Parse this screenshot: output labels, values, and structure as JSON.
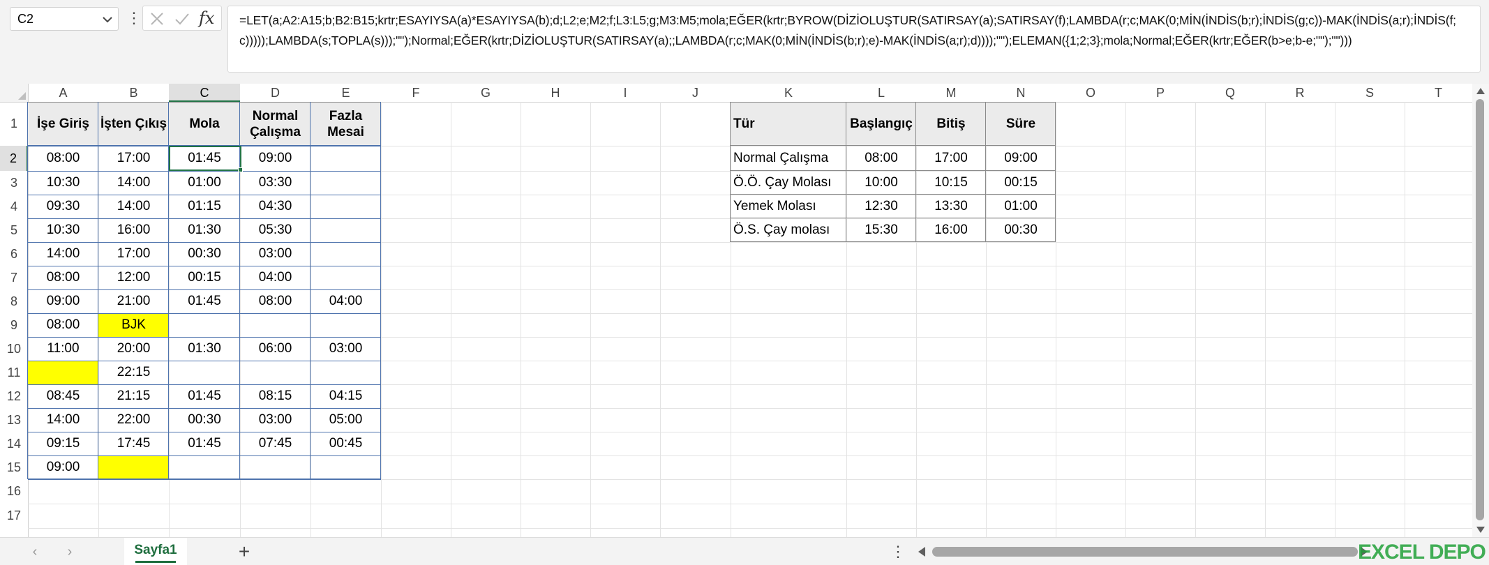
{
  "formula_bar": {
    "name_box": "C2",
    "formula": "=LET(a;A2:A15;b;B2:B15;krtr;ESAYIYSA(a)*ESAYIYSA(b);d;L2;e;M2;f;L3:L5;g;M3:M5;mola;EĞER(krtr;BYROW(DİZİOLUŞTUR(SATIRSAY(a);SATIRSAY(f);LAMBDA(r;c;MAK(0;MİN(İNDİS(b;r);İNDİS(g;c))-MAK(İNDİS(a;r);İNDİS(f;c)))));LAMBDA(s;TOPLA(s)));\"\");Normal;EĞER(krtr;DİZİOLUŞTUR(SATIRSAY(a);;LAMBDA(r;c;MAK(0;MİN(İNDİS(b;r);e)-MAK(İNDİS(a;r);d))));\"\");ELEMAN({1;2;3};mola;Normal;EĞER(krtr;EĞER(b>e;b-e;\"\");\"\")))",
    "fx_label": "fx"
  },
  "columns": [
    "A",
    "B",
    "C",
    "D",
    "E",
    "F",
    "G",
    "H",
    "I",
    "J",
    "K",
    "L",
    "M",
    "N",
    "O",
    "P",
    "Q",
    "R",
    "S",
    "T"
  ],
  "selected_column": "C",
  "selected_row": "2",
  "rows": [
    "1",
    "2",
    "3",
    "4",
    "5",
    "6",
    "7",
    "8",
    "9",
    "10",
    "11",
    "12",
    "13",
    "14",
    "15",
    "16",
    "17"
  ],
  "main_table": {
    "headers": [
      "İşe Giriş",
      "İşten Çıkış",
      "Mola",
      "Normal Çalışma",
      "Fazla Mesai"
    ],
    "rows": [
      [
        "08:00",
        "17:00",
        "01:45",
        "09:00",
        ""
      ],
      [
        "10:30",
        "14:00",
        "01:00",
        "03:30",
        ""
      ],
      [
        "09:30",
        "14:00",
        "01:15",
        "04:30",
        ""
      ],
      [
        "10:30",
        "16:00",
        "01:30",
        "05:30",
        ""
      ],
      [
        "14:00",
        "17:00",
        "00:30",
        "03:00",
        ""
      ],
      [
        "08:00",
        "12:00",
        "00:15",
        "04:00",
        ""
      ],
      [
        "09:00",
        "21:00",
        "01:45",
        "08:00",
        "04:00"
      ],
      [
        "08:00",
        "BJK",
        "",
        "",
        ""
      ],
      [
        "11:00",
        "20:00",
        "01:30",
        "06:00",
        "03:00"
      ],
      [
        "",
        "22:15",
        "",
        "",
        ""
      ],
      [
        "08:45",
        "21:15",
        "01:45",
        "08:15",
        "04:15"
      ],
      [
        "14:00",
        "22:00",
        "00:30",
        "03:00",
        "05:00"
      ],
      [
        "09:15",
        "17:45",
        "01:45",
        "07:45",
        "00:45"
      ],
      [
        "09:00",
        "",
        "",
        "",
        ""
      ]
    ],
    "highlight_color": "#ffff00"
  },
  "ref_table": {
    "headers": [
      "Tür",
      "Başlangıç",
      "Bitiş",
      "Süre"
    ],
    "rows": [
      [
        "Normal Çalışma",
        "08:00",
        "17:00",
        "09:00"
      ],
      [
        "Ö.Ö. Çay Molası",
        "10:00",
        "10:15",
        "00:15"
      ],
      [
        "Yemek Molası",
        "12:30",
        "13:30",
        "01:00"
      ],
      [
        "Ö.S. Çay molası",
        "15:30",
        "16:00",
        "00:30"
      ]
    ]
  },
  "sheet_tabs": {
    "active": "Sayfa1",
    "add_label": "+",
    "prev": "‹",
    "next": "›",
    "more": "⋮"
  },
  "watermark": "EXCEL DEPO",
  "colors": {
    "accent": "#217346",
    "table_border": "#4e73ad",
    "header_fill": "#ebebeb",
    "highlight": "#ffff00"
  }
}
